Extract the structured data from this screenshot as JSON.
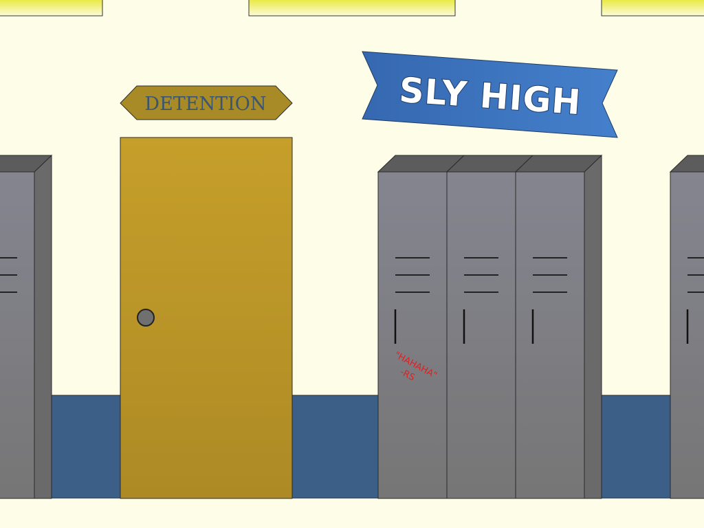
{
  "scene": {
    "name": "school-hallway",
    "detention_sign": {
      "label": "DETENTION"
    },
    "school_banner": {
      "label": "SLY HIGH"
    },
    "graffiti": {
      "line1": "\"HAHAHA\"",
      "line2": "-RS"
    },
    "colors": {
      "wall": "#fefee8",
      "floor_stripe": "#3b5f86",
      "ceiling_light": "#eeee44",
      "door": "#c39e2a",
      "door_knob": "#707070",
      "sign_plate": "#a88a26",
      "banner": "#3a73be",
      "locker_front": "#7d7d84",
      "locker_side": "#6a6a6a",
      "locker_top": "#5c5c5c",
      "graffiti": "#e02020"
    }
  }
}
